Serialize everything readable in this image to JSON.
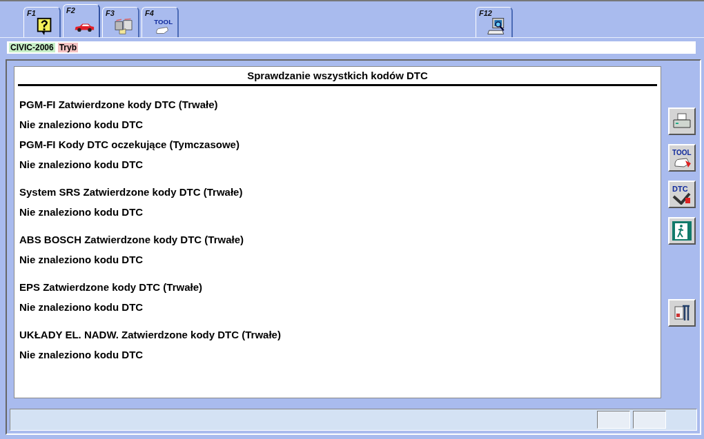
{
  "tabs": [
    {
      "key": "F1",
      "selected": false
    },
    {
      "key": "F2",
      "selected": true
    },
    {
      "key": "F3",
      "selected": false
    },
    {
      "key": "F4",
      "icon_text": "TOOL",
      "selected": false
    },
    {
      "key": "F12",
      "selected": false
    }
  ],
  "info_bar": {
    "model": "CIVIC-2006",
    "mode": "Tryb"
  },
  "report": {
    "title": "Sprawdzanie wszystkich kodów DTC",
    "sections": [
      {
        "heading": "PGM-FI Zatwierdzone kody DTC (Trwałe)",
        "result": "Nie znaleziono kodu DTC"
      },
      {
        "heading": "PGM-FI Kody DTC oczekujące (Tymczasowe)",
        "result": "Nie znaleziono kodu DTC"
      },
      {
        "heading": "System SRS Zatwierdzone kody DTC (Trwałe)",
        "result": "Nie znaleziono kodu DTC"
      },
      {
        "heading": "ABS BOSCH Zatwierdzone kody DTC (Trwałe)",
        "result": "Nie znaleziono kodu DTC"
      },
      {
        "heading": "EPS Zatwierdzone kody DTC (Trwałe)",
        "result": "Nie znaleziono kodu DTC"
      },
      {
        "heading": "UKŁADY EL. NADW. Zatwierdzone kody DTC (Trwałe)",
        "result": "Nie znaleziono kodu DTC"
      }
    ]
  },
  "side_buttons": {
    "tool_icon_text": "TOOL",
    "dtc_icon_text": "DTC"
  }
}
